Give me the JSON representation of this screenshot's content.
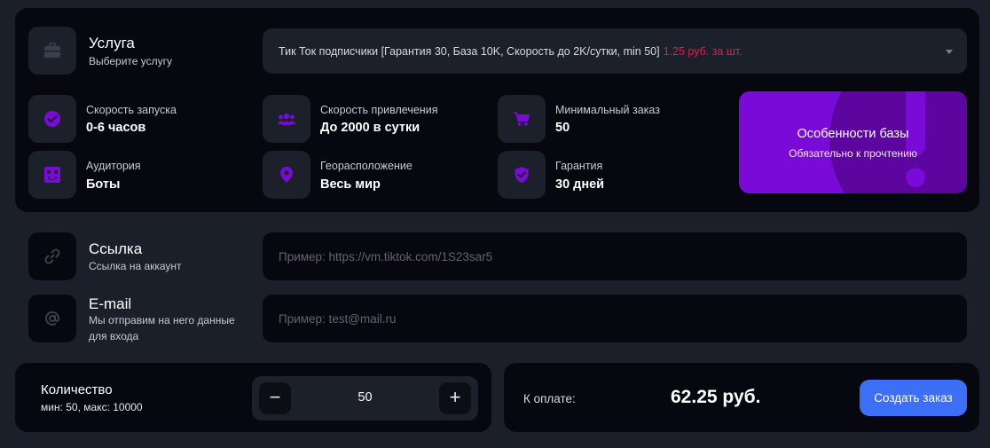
{
  "service": {
    "title": "Услуга",
    "subtitle": "Выберите услугу",
    "selected_text": "Тик Ток подписчики [Гарантия 30, База 10K, Скорость до 2K/сутки, min 50]",
    "selected_price": "1.25 руб. за шт.",
    "icon": "briefcase-icon"
  },
  "stats": [
    {
      "label": "Скорость запуска",
      "value": "0-6 часов",
      "icon": "check-circle-icon"
    },
    {
      "label": "Скорость привлечения",
      "value": "До 2000 в сутки",
      "icon": "users-icon"
    },
    {
      "label": "Минимальный заказ",
      "value": "50",
      "icon": "cart-icon"
    },
    {
      "label": "Аудитория",
      "value": "Боты",
      "icon": "bot-icon"
    },
    {
      "label": "Георасположение",
      "value": "Весь мир",
      "icon": "location-pin-icon"
    },
    {
      "label": "Гарантия",
      "value": "30 дней",
      "icon": "shield-check-icon"
    }
  ],
  "promo": {
    "title": "Особенности базы",
    "subtitle": "Обязательно к прочтению"
  },
  "link": {
    "title": "Ссылка",
    "subtitle": "Ссылка на аккаунт",
    "placeholder": "Пример: https://vm.tiktok.com/1S23sar5",
    "value": "",
    "icon": "link-icon"
  },
  "email": {
    "title": "E-mail",
    "subtitle_line1": "Мы отправим на него данные",
    "subtitle_line2": "для входа",
    "placeholder": "Пример: test@mail.ru",
    "value": "",
    "icon": "at-icon"
  },
  "quantity": {
    "title": "Количество",
    "subtitle": "мин: 50, макс: 10000",
    "value": "50",
    "minus": "−",
    "plus": "+"
  },
  "payment": {
    "label": "К оплате:",
    "amount": "62.25 руб.",
    "button": "Создать заказ"
  },
  "colors": {
    "accent_purple": "#7a0ad8",
    "price_red": "#e8194e",
    "button_blue": "#3d6ef6"
  }
}
